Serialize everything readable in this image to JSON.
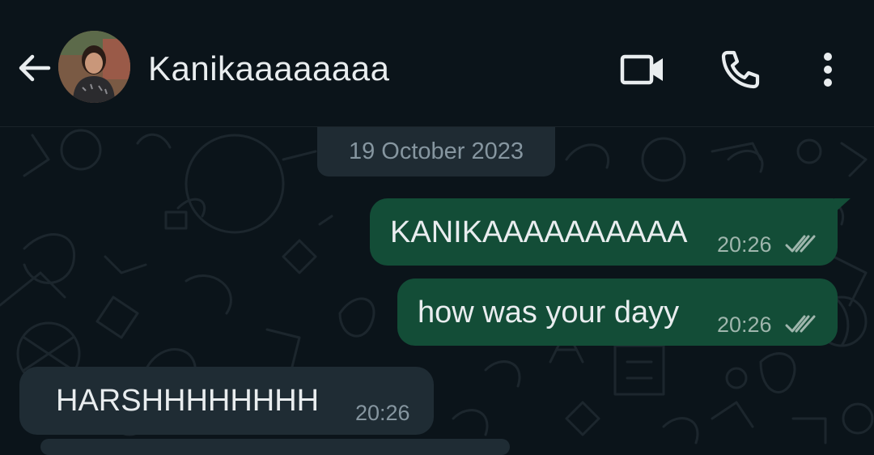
{
  "header": {
    "contact_name": "Kanikaaaaaaaa",
    "icons": [
      "back-arrow-icon",
      "avatar",
      "video-call-icon",
      "voice-call-icon",
      "more-options-icon"
    ]
  },
  "chat": {
    "date_divider": "19 October 2023",
    "messages": [
      {
        "direction": "outgoing",
        "text": "KANIKAAAAAAAAAA",
        "time": "20:26",
        "status": "read"
      },
      {
        "direction": "outgoing",
        "text": "how was your dayy",
        "time": "20:26",
        "status": "read"
      },
      {
        "direction": "incoming",
        "text": "HARSHHHHHHHH",
        "time": "20:26"
      }
    ]
  },
  "colors": {
    "background": "#0b141a",
    "outgoing_bubble": "#134d37",
    "incoming_bubble": "#1f2c34",
    "date_chip": "#1f2b33",
    "primary_text": "#e9edef",
    "secondary_text": "#8696a0"
  }
}
